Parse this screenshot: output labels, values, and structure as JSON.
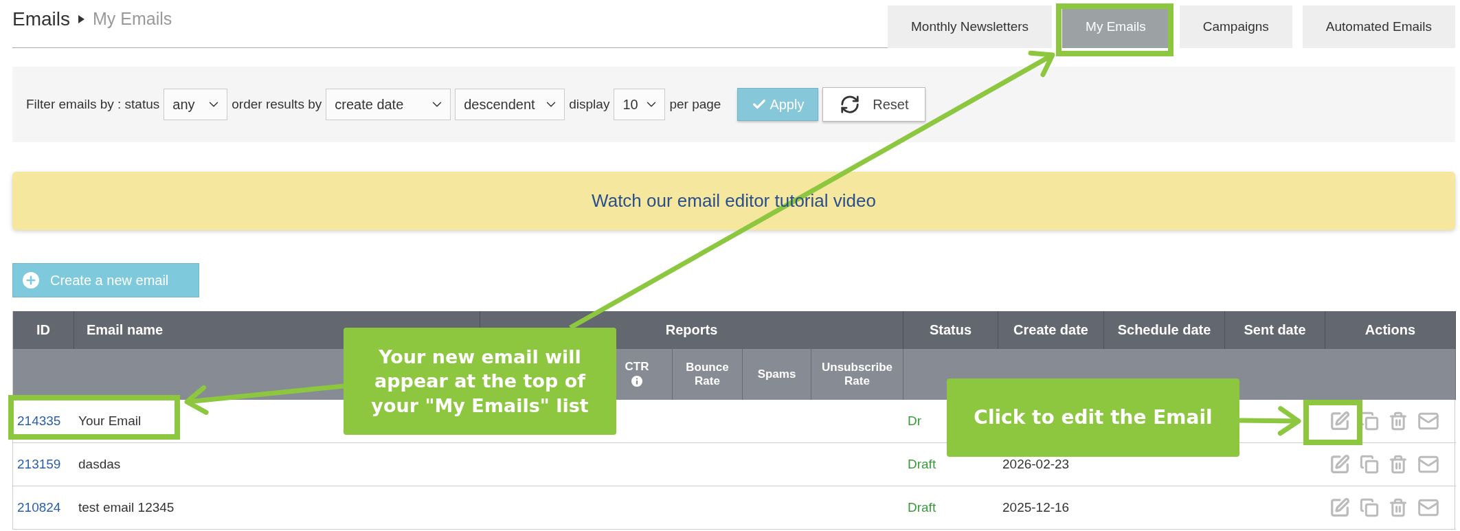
{
  "breadcrumb": {
    "title": "Emails",
    "current": "My Emails"
  },
  "tabs": [
    {
      "label": "Monthly Newsletters",
      "selected": false
    },
    {
      "label": "My Emails",
      "selected": true
    },
    {
      "label": "Campaigns",
      "selected": false
    },
    {
      "label": "Automated Emails",
      "selected": false
    }
  ],
  "filter": {
    "status_label": "Filter emails by : status",
    "status": "any",
    "order_label": "order results by",
    "order": "create date",
    "direction": "descendent",
    "display_label": "display",
    "per_page": "10",
    "per_page_label": "per page",
    "apply": "Apply",
    "reset": "Reset"
  },
  "banner": "Watch our email editor tutorial video",
  "create_button": "Create a new email",
  "table": {
    "columns": [
      "ID",
      "Email name",
      "Reports",
      "Status",
      "Create date",
      "Schedule date",
      "Sent date",
      "Actions"
    ],
    "report_columns": [
      {
        "label": "CTR",
        "kind": "info"
      },
      {
        "label": "Bounce Rate",
        "kind": "plain"
      },
      {
        "label": "Spams",
        "kind": "plain"
      },
      {
        "label": "Unsubscribe Rate",
        "kind": "plain"
      }
    ],
    "rows": [
      {
        "id": "214335",
        "name": "Your Email",
        "status": "Dr"
      },
      {
        "id": "213159",
        "name": "dasdas",
        "status": "Draft",
        "create_date": "2026-02-23"
      },
      {
        "id": "210824",
        "name": "test email 12345",
        "status": "Draft",
        "create_date": "2025-12-16"
      }
    ]
  },
  "annotations": [
    {
      "text": "Your new email will appear at the top of your \"My Emails\" list"
    },
    {
      "text": "Click to edit the Email"
    }
  ]
}
